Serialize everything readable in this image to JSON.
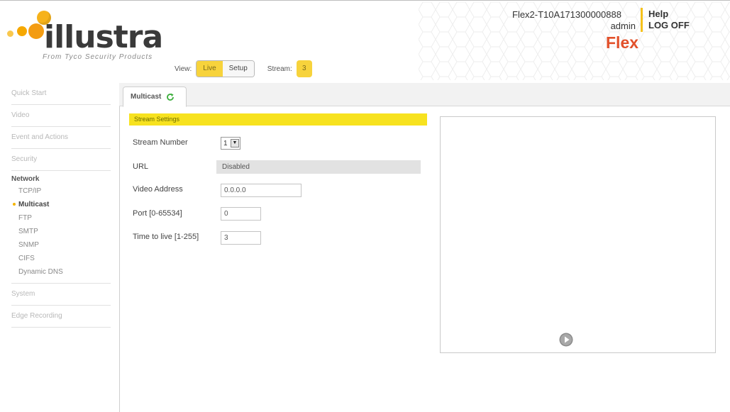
{
  "header": {
    "logo_text": "illustra",
    "logo_subtitle": "From Tyco Security Products",
    "device_name": "Flex2-T10A171300000888",
    "user": "admin",
    "help_label": "Help",
    "logoff_label": "LOG OFF",
    "brand": "Flex",
    "view_label": "View:",
    "view_options": [
      "Live",
      "Setup"
    ],
    "active_view": "Live",
    "stream_label": "Stream:",
    "stream_value": "3"
  },
  "sidebar": {
    "top_items": [
      "Quick Start",
      "Video",
      "Event and Actions",
      "Security"
    ],
    "group": {
      "title": "Network",
      "items": [
        "TCP/IP",
        "Multicast",
        "FTP",
        "SMTP",
        "SNMP",
        "CIFS",
        "Dynamic DNS"
      ],
      "active": "Multicast"
    },
    "bottom_items": [
      "System",
      "Edge Recording"
    ]
  },
  "main": {
    "tab_label": "Multicast",
    "section_title": "Stream Settings",
    "fields": {
      "stream_number_label": "Stream Number",
      "stream_number_value": "1",
      "url_label": "URL",
      "url_value": "Disabled",
      "video_address_label": "Video Address",
      "video_address_value": "0.0.0.0",
      "port_label": "Port [0-65534]",
      "port_value": "0",
      "ttl_label": "Time to live [1-255]",
      "ttl_value": "3"
    }
  },
  "colors": {
    "accent_yellow": "#f7d33c",
    "section_yellow": "#f7e21f",
    "brand_red": "#e2502a",
    "logo_orange": "#f6a800",
    "refresh_green": "#3cae3c"
  },
  "icons": [
    "refresh-icon",
    "play-icon",
    "select-arrow-icon"
  ]
}
